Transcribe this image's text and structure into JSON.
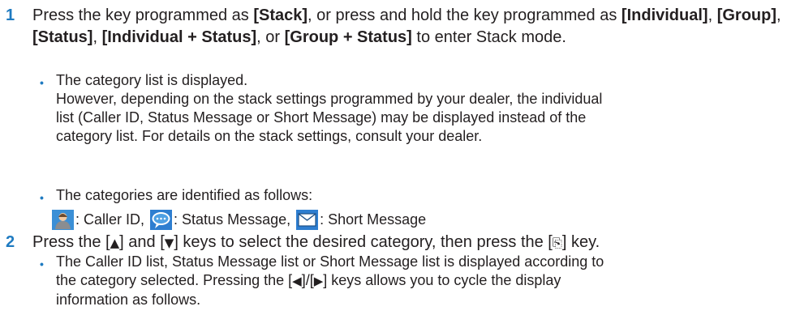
{
  "step1": {
    "number": "1",
    "t_press": "Press the key programmed as ",
    "k_stack": "[Stack]",
    "t_or": ", or press and hold the key programmed as ",
    "k_individual": "[Individual]",
    "sep1": ", ",
    "k_group": "[Group]",
    "sep2": ", ",
    "k_status": "[Status]",
    "sep3": ", ",
    "k_ind_status": "[Individual + Status]",
    "t_or2": ", or ",
    "k_group_status": "[Group + Status]",
    "t_end": " to enter Stack mode.",
    "bullet1_line1": "The category list is displayed.",
    "bullet1_line2": "However, depending on the stack settings programmed by your dealer, the individual",
    "bullet1_line3": "list (Caller ID, Status Message or Short Message) may be displayed instead of the",
    "bullet1_line4": "category list. For details on the stack settings, consult your dealer.",
    "bullet2": "The categories are identified as follows:",
    "icon_caller_label": ": Caller ID, ",
    "icon_status_label": ": Status Message, ",
    "icon_short_label": ": Short Message"
  },
  "step2": {
    "number": "2",
    "t1": "Press the [",
    "up": "▲",
    "t2": "] and [",
    "down": "▼",
    "t3": "] keys to select the desired category, then press the [",
    "ok": "⎘",
    "t4": "] key.",
    "bullet_line1": "The Caller ID list, Status Message list or Short Message list is displayed according to",
    "bullet_line2a": "the category selected. Pressing the [",
    "left": "◀",
    "bullet_line2b": "]/[",
    "right": "▶",
    "bullet_line2c": "] keys allows you to cycle the display",
    "bullet_line3": "information as follows."
  },
  "bullet_glyph": "•",
  "colors": {
    "accent": "#1f7bc1",
    "text": "#231f20"
  },
  "icons": [
    "person-icon",
    "speech-bubble-icon",
    "envelope-icon"
  ]
}
